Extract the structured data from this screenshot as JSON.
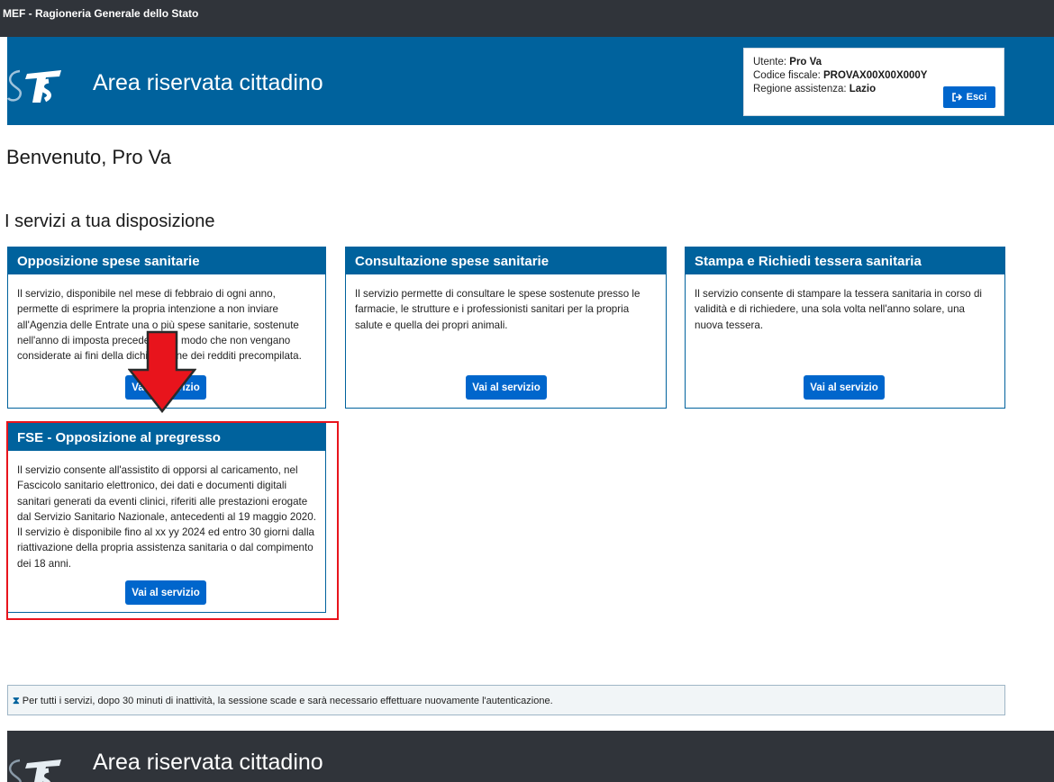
{
  "topbar": {
    "text": "MEF - Ragioneria Generale dello Stato"
  },
  "header": {
    "title": "Area riservata cittadino"
  },
  "user": {
    "utente_label": "Utente: ",
    "utente_value": "Pro Va",
    "cf_label": "Codice fiscale: ",
    "cf_value": "PROVAX00X00X000Y",
    "regione_label": "Regione assistenza: ",
    "regione_value": "Lazio",
    "logout_label": "Esci"
  },
  "welcome": "Benvenuto, Pro Va",
  "services_title": "I servizi a tua disposizione",
  "cards": [
    {
      "title": "Opposizione spese sanitarie",
      "body": "Il servizio, disponibile nel mese di febbraio di ogni anno, permette di esprimere la propria intenzione a non inviare all'Agenzia delle Entrate una o più spese sanitarie, sostenute nell'anno di imposta precedente, in modo che non vengano considerate ai fini della dichiarazione dei redditi precompilata.",
      "button": "Vai al servizio"
    },
    {
      "title": "Consultazione spese sanitarie",
      "body": "Il servizio permette di consultare le spese sostenute presso le farmacie, le strutture e i professionisti sanitari per la propria salute e quella dei propri animali.",
      "button": "Vai al servizio"
    },
    {
      "title": "Stampa e Richiedi tessera sanitaria",
      "body": "Il servizio consente di stampare la tessera sanitaria in corso di validità e di richiedere, una sola volta nell'anno solare, una nuova tessera.",
      "button": "Vai al servizio"
    },
    {
      "title": "FSE - Opposizione al pregresso",
      "body": "Il servizio consente all'assistito di opporsi al caricamento, nel Fascicolo sanitario elettronico, dei dati e documenti digitali sanitari generati da eventi clinici, riferiti alle prestazioni erogate dal Servizio Sanitario Nazionale, antecedenti al 19 maggio 2020. Il servizio è disponibile fino al xx yy 2024 ed entro 30 giorni dalla riattivazione della propria assistenza sanitaria o dal compimento dei 18 anni.",
      "button": "Vai al servizio"
    }
  ],
  "notice": "Per tutti i servizi, dopo 30 minuti di inattività, la sessione scade e sarà necessario effettuare nuovamente l'autenticazione.",
  "footer": {
    "title": "Area riservata cittadino"
  },
  "icons": {
    "logo": "sts-logo-icon",
    "logout": "sign-out-icon",
    "notice": "hourglass-icon",
    "annotation": "red-arrow-down-icon"
  },
  "colors": {
    "header_blue": "#00629d",
    "button_blue": "#0066cc",
    "dark_bar": "#30343a",
    "highlight_red": "#e8141c"
  }
}
